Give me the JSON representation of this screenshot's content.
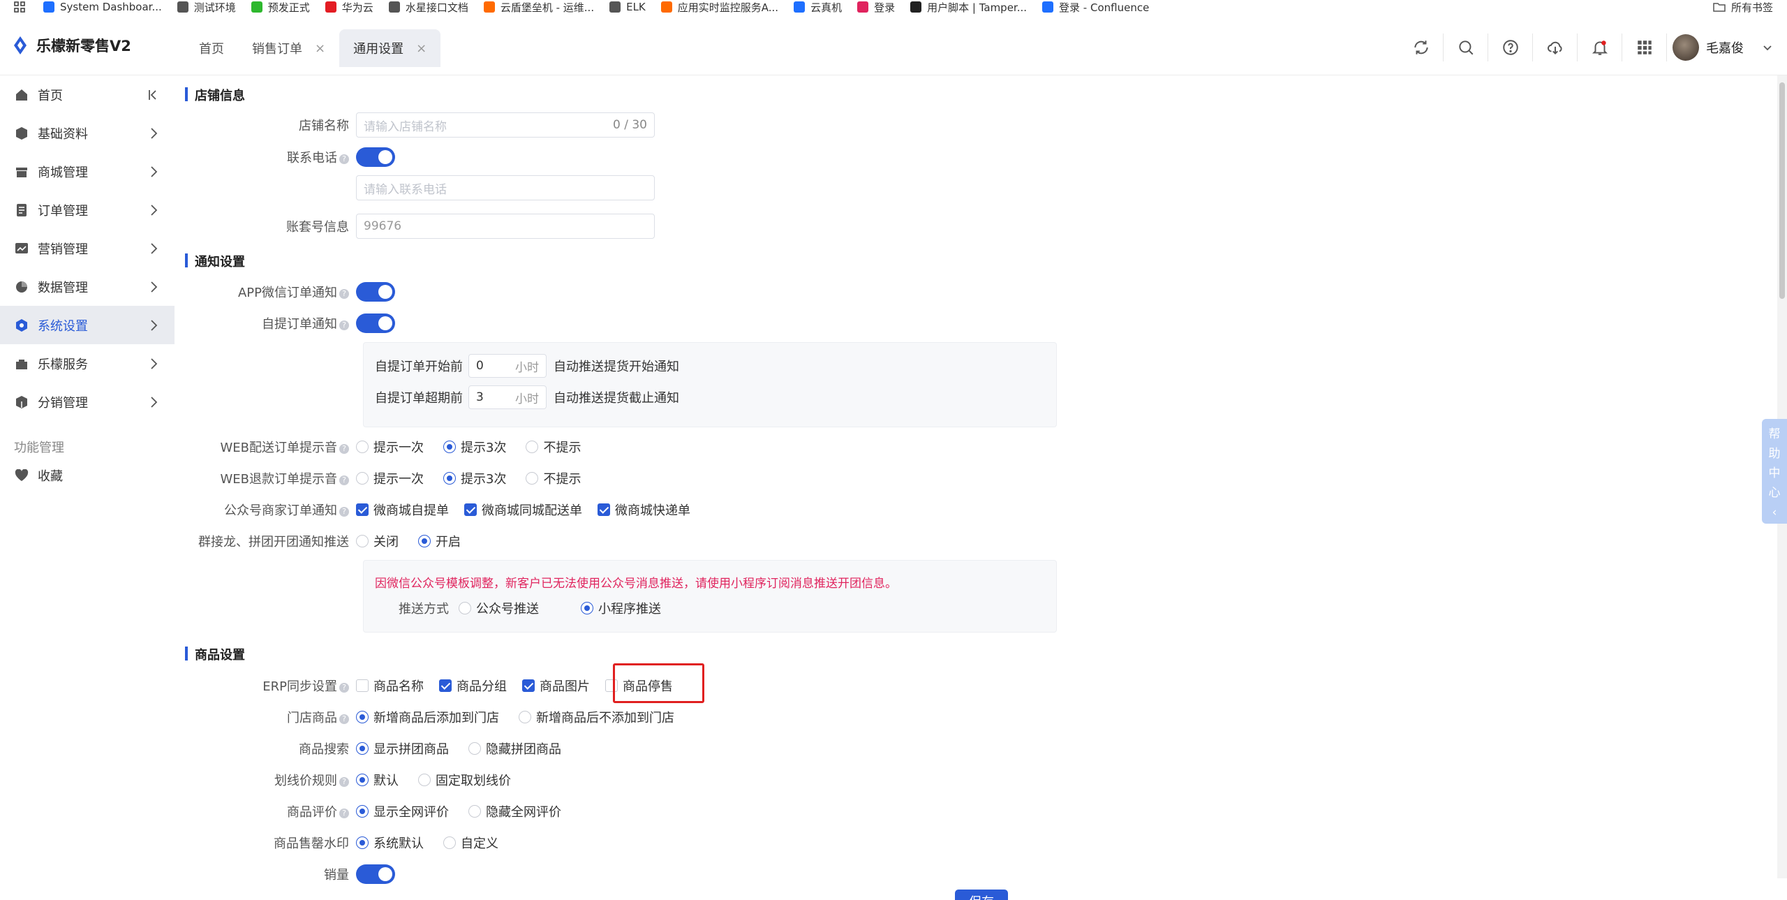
{
  "bookmarks": {
    "items": [
      {
        "label": "System Dashboar...",
        "color": "#1e6fff"
      },
      {
        "label": "测试环境",
        "color": "#555555"
      },
      {
        "label": "预发正式",
        "color": "#2eb82e"
      },
      {
        "label": "华为云",
        "color": "#e31c23"
      },
      {
        "label": "水星接口文档",
        "color": "#555555"
      },
      {
        "label": "云盾堡垒机 - 运维...",
        "color": "#ff6a00"
      },
      {
        "label": "ELK",
        "color": "#555555"
      },
      {
        "label": "应用实时监控服务A...",
        "color": "#ff6a00"
      },
      {
        "label": "云真机",
        "color": "#1e6fff"
      },
      {
        "label": "登录",
        "color": "#e0245e"
      },
      {
        "label": "用户脚本 | Tamper...",
        "color": "#222222"
      },
      {
        "label": "登录 - Confluence",
        "color": "#1e6fff"
      }
    ],
    "all_bookmarks": "所有书签"
  },
  "header": {
    "app_title": "乐檬新零售V2",
    "tabs": [
      {
        "label": "首页",
        "closable": false,
        "active": false
      },
      {
        "label": "销售订单",
        "closable": true,
        "active": false
      },
      {
        "label": "通用设置",
        "closable": true,
        "active": true
      }
    ],
    "close_glyph": "×",
    "user_name": "毛嘉俊"
  },
  "sidebar": {
    "items": [
      {
        "label": "首页",
        "icon": "home-icon"
      },
      {
        "label": "基础资料",
        "icon": "cube-icon"
      },
      {
        "label": "商城管理",
        "icon": "store-icon"
      },
      {
        "label": "订单管理",
        "icon": "order-icon"
      },
      {
        "label": "营销管理",
        "icon": "marketing-icon"
      },
      {
        "label": "数据管理",
        "icon": "pie-chart-icon"
      },
      {
        "label": "系统设置",
        "icon": "settings-icon",
        "active": true
      },
      {
        "label": "乐檬服务",
        "icon": "service-icon"
      },
      {
        "label": "分销管理",
        "icon": "distribution-icon"
      }
    ],
    "group_label": "功能管理",
    "favorites_label": "收藏"
  },
  "main": {
    "store_section": {
      "title": "店铺信息",
      "store_name_label": "店铺名称",
      "store_name_placeholder": "请输入店铺名称",
      "store_name_count": "0 / 30",
      "phone_label": "联系电话",
      "phone_placeholder": "请输入联系电话",
      "account_label": "账套号信息",
      "account_value": "99676"
    },
    "notify_section": {
      "title": "通知设置",
      "app_wechat_label": "APP微信订单通知",
      "pickup_label": "自提订单通知",
      "pickup_start_prefix": "自提订单开始前",
      "pickup_start_value": "0",
      "pickup_start_suffix": "自动推送提货开始通知",
      "pickup_end_prefix": "自提订单超期前",
      "pickup_end_value": "3",
      "pickup_end_suffix": "自动推送提货截止通知",
      "hour_unit": "小时",
      "web_delivery_label": "WEB配送订单提示音",
      "web_refund_label": "WEB退款订单提示音",
      "sound_options": [
        "提示一次",
        "提示3次",
        "不提示"
      ],
      "sound_selected": "提示3次",
      "official_label": "公众号商家订单通知",
      "official_options": [
        "微商城自提单",
        "微商城同城配送单",
        "微商城快递单"
      ],
      "group_buy_label": "群接龙、拼团开团通知推送",
      "group_buy_options": [
        "关闭",
        "开启"
      ],
      "group_buy_selected": "开启",
      "warning": "因微信公众号模板调整，新客户已无法使用公众号消息推送，请使用小程序订阅消息推送开团信息。",
      "push_method_label": "推送方式",
      "push_options": [
        "公众号推送",
        "小程序推送"
      ],
      "push_selected": "小程序推送"
    },
    "goods_section": {
      "title": "商品设置",
      "erp_label": "ERP同步设置",
      "erp_options": [
        {
          "label": "商品名称",
          "checked": false
        },
        {
          "label": "商品分组",
          "checked": true
        },
        {
          "label": "商品图片",
          "checked": true
        },
        {
          "label": "商品停售",
          "checked": false
        }
      ],
      "store_goods_label": "门店商品",
      "store_goods_options": [
        "新增商品后添加到门店",
        "新增商品后不添加到门店"
      ],
      "search_label": "商品搜索",
      "search_options": [
        "显示拼团商品",
        "隐藏拼团商品"
      ],
      "strike_label": "划线价规则",
      "strike_options": [
        "默认",
        "固定取划线价"
      ],
      "review_label": "商品评价",
      "review_options": [
        "显示全网评价",
        "隐藏全网评价"
      ],
      "watermark_label": "商品售罄水印",
      "watermark_options": [
        "系统默认",
        "自定义"
      ],
      "sales_label": "销量"
    },
    "help_text": [
      "帮",
      "助",
      "中",
      "心",
      "‹"
    ],
    "save_label": "保存"
  },
  "colors": {
    "accent": "#2a5bd7",
    "warning": "#e0245e",
    "highlight": "#e02020"
  }
}
